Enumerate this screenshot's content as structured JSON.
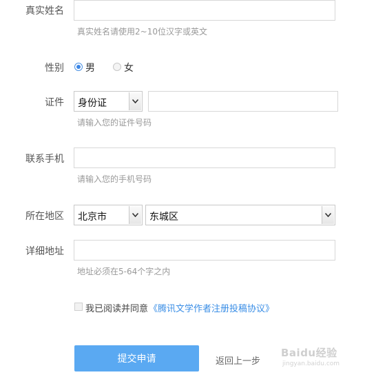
{
  "form": {
    "name": {
      "label": "真实姓名",
      "value": "",
      "hint": "真实姓名请使用2~10位汉字或英文"
    },
    "gender": {
      "label": "性别",
      "options": [
        "男",
        "女"
      ],
      "selected": "男"
    },
    "id": {
      "label": "证件",
      "type_selected": "身份证",
      "number": "",
      "hint": "请输入您的证件号码"
    },
    "phone": {
      "label": "联系手机",
      "value": "",
      "hint": "请输入您的手机号码"
    },
    "region": {
      "label": "所在地区",
      "city": "北京市",
      "district": "东城区"
    },
    "address": {
      "label": "详细地址",
      "value": "",
      "hint": "地址必须在5-64个字之内"
    },
    "agreement": {
      "text": "我已阅读并同意",
      "link": "《腾讯文学作者注册投稿协议》",
      "checked": false
    },
    "submit_label": "提交申请",
    "back_label": "返回上一步"
  },
  "watermark": {
    "text": "Baidu经验",
    "sub": "jingyan.baidu.com"
  },
  "colors": {
    "accent": "#5aa9f2",
    "link": "#3a8ee6",
    "hint": "#999999"
  }
}
